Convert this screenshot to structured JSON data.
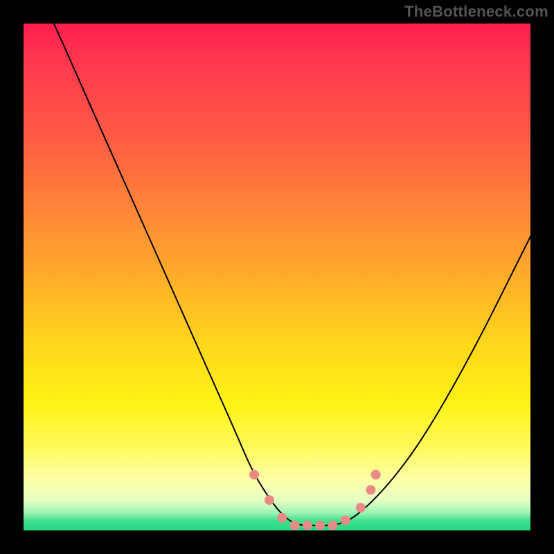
{
  "watermark": "TheBottleneck.com",
  "chart_data": {
    "type": "line",
    "title": "",
    "xlabel": "",
    "ylabel": "",
    "xlim": [
      0,
      100
    ],
    "ylim": [
      0,
      100
    ],
    "axes_visible": false,
    "grid": false,
    "legend": false,
    "background_gradient": {
      "direction": "vertical",
      "stops": [
        {
          "pct": 0,
          "color": "#ff1e4c"
        },
        {
          "pct": 22,
          "color": "#ff5a44"
        },
        {
          "pct": 52,
          "color": "#ffb327"
        },
        {
          "pct": 75,
          "color": "#fff214"
        },
        {
          "pct": 90,
          "color": "#fdffa8"
        },
        {
          "pct": 98,
          "color": "#44e28e"
        },
        {
          "pct": 100,
          "color": "#1fda82"
        }
      ]
    },
    "series": [
      {
        "name": "bottleneck-curve",
        "color": "#000000",
        "width": 2,
        "x": [
          6,
          10,
          14,
          18,
          22,
          26,
          30,
          34,
          38,
          42,
          45,
          48,
          51,
          54,
          58,
          62,
          66,
          72,
          78,
          84,
          90,
          96,
          100
        ],
        "y": [
          100,
          91,
          82,
          73,
          64,
          55,
          46,
          37,
          28,
          19,
          12,
          7,
          3,
          1,
          1,
          1,
          3,
          9,
          17,
          27,
          38,
          50,
          58
        ]
      }
    ],
    "markers": {
      "name": "highlight-dots",
      "color": "#e98a86",
      "radius_px": 7,
      "points": [
        {
          "x": 45.5,
          "y": 11
        },
        {
          "x": 48.5,
          "y": 6
        },
        {
          "x": 51.0,
          "y": 2.5
        },
        {
          "x": 53.5,
          "y": 1
        },
        {
          "x": 56.0,
          "y": 1
        },
        {
          "x": 58.5,
          "y": 1
        },
        {
          "x": 61.0,
          "y": 1
        },
        {
          "x": 63.5,
          "y": 2
        },
        {
          "x": 66.5,
          "y": 4.5
        },
        {
          "x": 68.5,
          "y": 8
        },
        {
          "x": 69.5,
          "y": 11
        }
      ]
    }
  }
}
